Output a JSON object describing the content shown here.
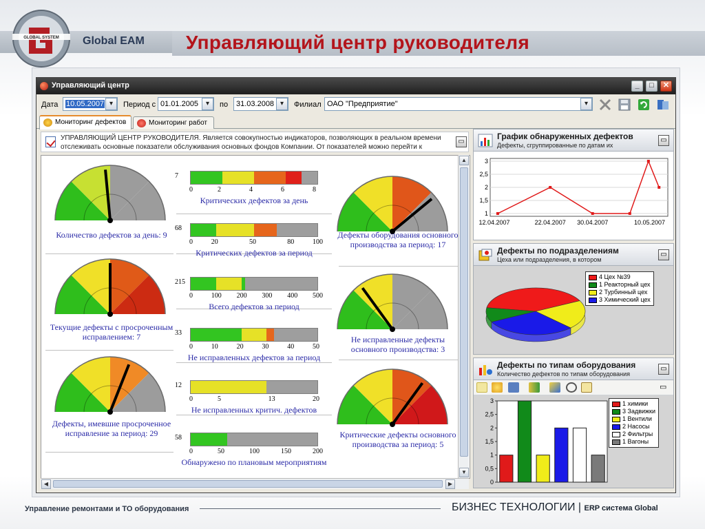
{
  "slide": {
    "brand": "Global EAM",
    "logo_text": "GLOBAL SYSTEM",
    "title": "Управляющий центр руководителя",
    "footer_left": "Управление ремонтами и ТО оборудования",
    "footer_right_main": "БИЗНЕС ТЕХНОЛОГИИ",
    "footer_right_sep": "|",
    "footer_right_small": "ERP система Global"
  },
  "window": {
    "title": "Управляющий центр",
    "buttons": {
      "minimize": "_",
      "maximize": "□",
      "close": "✕"
    }
  },
  "filters": {
    "date_label": "Дата",
    "date_value": "10.05.2007",
    "period_from_label": "Период с",
    "period_from_value": "01.01.2005",
    "period_to_label": "по",
    "period_to_value": "31.03.2008",
    "branch_label": "Филиал",
    "branch_value": "ОАО \"Предприятие\"",
    "dropdown_glyph": "▾"
  },
  "tabs": [
    {
      "label": "Мониторинг дефектов",
      "active": true
    },
    {
      "label": "Мониторинг работ",
      "active": false
    }
  ],
  "info_text": "УПРАВЛЯЮЩИЙ ЦЕНТР РУКОВОДИТЕЛЯ. Является совокупностью индикаторов, позволяющих в реальном времени отслеживать основные показатели обслуживания основных фондов Компании. От показателей можно перейти к",
  "gauges": [
    {
      "label": "Количество дефектов за день: 9",
      "bands": [
        "#2fbe1c",
        "#c7e032",
        "#9c9c9c",
        "#9c9c9c"
      ],
      "needle": 0.47
    },
    {
      "label": "Текущие дефекты с просроченным исправлением: 7",
      "bands": [
        "#2fbe1c",
        "#f0e028",
        "#e05a18",
        "#cc2b12"
      ],
      "needle": 0.5
    },
    {
      "label": "Дефекты, имевшие просроченное исправление за период: 29",
      "bands": [
        "#2fbe1c",
        "#f0e028",
        "#f08a26",
        "#9c9c9c"
      ],
      "needle": 0.62
    },
    {
      "label": "Дефекты оборудования основного производства за период: 17",
      "bands": [
        "#2fbe1c",
        "#f0e028",
        "#e0561a",
        "#9c9c9c"
      ],
      "needle": 0.78
    },
    {
      "label": "Не исправленные дефекты основного производства: 3",
      "bands": [
        "#2fbe1c",
        "#f0e028",
        "#9c9c9c",
        "#9c9c9c"
      ],
      "needle": 0.3
    },
    {
      "label": "Критические дефекты основного производства за период: 5",
      "bands": [
        "#2fbe1c",
        "#f0e028",
        "#e0561a",
        "#d0181a"
      ],
      "needle": 0.7
    }
  ],
  "bars": [
    {
      "value": "7",
      "title": "Критических дефектов за день",
      "max": 8,
      "segments": [
        {
          "from": 0,
          "to": 2,
          "color": "#33c521"
        },
        {
          "from": 2,
          "to": 4,
          "color": "#e6e127"
        },
        {
          "from": 4,
          "to": 6,
          "color": "#e6661c"
        },
        {
          "from": 6,
          "to": 7,
          "color": "#e0201a"
        }
      ],
      "ticks": [
        "0",
        "2",
        "4",
        "6",
        "8"
      ],
      "tick_values": [
        0,
        2,
        4,
        6,
        8
      ]
    },
    {
      "value": "68",
      "title": "Критических дефектов за период",
      "max": 100,
      "segments": [
        {
          "from": 0,
          "to": 20,
          "color": "#33c521"
        },
        {
          "from": 20,
          "to": 50,
          "color": "#e6e127"
        },
        {
          "from": 50,
          "to": 68,
          "color": "#e6661c"
        }
      ],
      "ticks": [
        "0",
        "20",
        "50",
        "80",
        "100"
      ],
      "tick_values": [
        0,
        20,
        50,
        80,
        100
      ]
    },
    {
      "value": "215",
      "title": "Всего дефектов за период",
      "max": 500,
      "segments": [
        {
          "from": 0,
          "to": 100,
          "color": "#33c521"
        },
        {
          "from": 100,
          "to": 200,
          "color": "#e6e127"
        },
        {
          "from": 200,
          "to": 215,
          "color": "#33c521"
        }
      ],
      "ticks": [
        "0",
        "100",
        "200",
        "300",
        "400",
        "500"
      ],
      "tick_values": [
        0,
        100,
        200,
        300,
        400,
        500
      ]
    },
    {
      "value": "33",
      "title": "Не исправленных дефектов за период",
      "max": 50,
      "segments": [
        {
          "from": 0,
          "to": 20,
          "color": "#33c521"
        },
        {
          "from": 20,
          "to": 30,
          "color": "#e6e127"
        },
        {
          "from": 30,
          "to": 33,
          "color": "#e6661c"
        }
      ],
      "ticks": [
        "0",
        "10",
        "20",
        "30",
        "40",
        "50"
      ],
      "tick_values": [
        0,
        10,
        20,
        30,
        40,
        50
      ]
    },
    {
      "value": "12",
      "title": "Не исправленных критич. дефектов",
      "max": 20,
      "segments": [
        {
          "from": 0,
          "to": 12,
          "color": "#e6e127"
        }
      ],
      "ticks": [
        "0",
        "5",
        "13",
        "20"
      ],
      "tick_values": [
        0,
        5,
        13,
        20
      ]
    },
    {
      "value": "58",
      "title": "Обнаружено по плановым мероприятиям",
      "max": 200,
      "segments": [
        {
          "from": 0,
          "to": 50,
          "color": "#33c521"
        },
        {
          "from": 50,
          "to": 58,
          "color": "#33c521"
        }
      ],
      "ticks": [
        "0",
        "50",
        "100",
        "150",
        "200"
      ],
      "tick_values": [
        0,
        50,
        100,
        150,
        200
      ]
    }
  ],
  "panels": {
    "defects_chart": {
      "title": "График обнаруженных дефектов",
      "subtitle": "Дефекты, сгруппированные по датам их"
    },
    "by_division": {
      "title": "Дефекты по подразделениям",
      "subtitle": "Цеха или подразделения, в котором"
    },
    "by_equipment": {
      "title": "Дефекты по типам оборудования",
      "subtitle": "Количество дефектов по типам оборудования"
    }
  },
  "chart_data": [
    {
      "type": "line",
      "x": [
        "12.04.2007",
        "22.04.2007",
        "30.04.2007",
        "07.05.2007",
        "09.05.2007",
        "10.05.2007"
      ],
      "series": [
        {
          "values": [
            1,
            2,
            1,
            1,
            3,
            2
          ]
        }
      ],
      "x_tick_labels": [
        "12.04.2007",
        "22.04.2007",
        "30.04.2007",
        "10.05.2007"
      ],
      "y_ticks": [
        "1",
        "1,5",
        "2",
        "2,5",
        "3"
      ],
      "ylim": [
        1,
        3
      ],
      "color": "#e01a1a",
      "grid": true
    },
    {
      "type": "pie",
      "labels": [
        "4 Цех №39",
        "1 Реакторный цех",
        "2 Турбинный цех",
        "3 Химический цех"
      ],
      "values": [
        4,
        1,
        2,
        3
      ],
      "colors": [
        "#ef1a1a",
        "#118a1a",
        "#f0ec1a",
        "#1a1ae8"
      ],
      "legend": "right"
    },
    {
      "type": "bar",
      "categories": [
        "1 химики",
        "3 Задвижки",
        "1 Вентили",
        "2 Насосы",
        "2 Фильтры",
        "1 Вагоны"
      ],
      "values": [
        1,
        3,
        1,
        2,
        2,
        1
      ],
      "colors": [
        "#e01a1a",
        "#118a1a",
        "#f0ec1a",
        "#1a1ae8",
        "#ffffff",
        "#7a7a7a"
      ],
      "y_ticks": [
        "0",
        "0,5",
        "1",
        "1,5",
        "2",
        "2,5",
        "3"
      ],
      "ylim": [
        0,
        3
      ],
      "legend": "top-right"
    }
  ]
}
